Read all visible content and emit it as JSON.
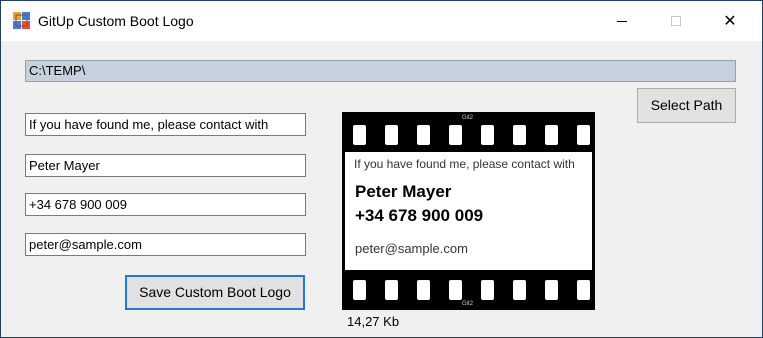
{
  "window": {
    "title": "GitUp Custom Boot Logo",
    "controls": {
      "minimize": "minimize-icon",
      "maximize": "maximize-icon",
      "close": "✕"
    }
  },
  "path": {
    "value": "C:\\TEMP\\"
  },
  "buttons": {
    "select_path": "Select Path",
    "save": "Save Custom Boot Logo"
  },
  "fields": {
    "tagline": "If you have found me, please contact with",
    "name": "Peter Mayer",
    "phone": "+34 678 900 009",
    "email": "peter@sample.com"
  },
  "preview": {
    "film_mark": "Git2",
    "tagline": "If you have found me, please contact with",
    "name": "Peter Mayer",
    "phone": "+34 678 900 009",
    "email": "peter@sample.com",
    "file_size": "14,27 Kb"
  },
  "colors": {
    "path_field_bg": "#c5d2de",
    "focus_border": "#1f7cd4",
    "window_border": "#1f3f6b"
  }
}
